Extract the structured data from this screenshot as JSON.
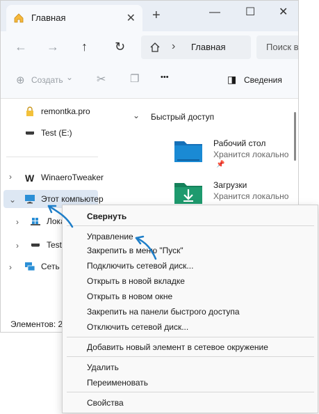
{
  "window": {
    "tab_title": "Главная",
    "new_tab": "+",
    "controls": {
      "minimize": "—",
      "maximize": "☐",
      "close": "✕"
    },
    "tab_close": "✕"
  },
  "nav": {
    "back": "←",
    "forward": "→",
    "up": "↑",
    "refresh": "↻",
    "address": "Главная",
    "address_chevron": "›",
    "search_placeholder": "Поиск в"
  },
  "toolbar": {
    "create_label": "Создать",
    "create_chevron": "⌄",
    "more": "•••",
    "details_label": "Сведения"
  },
  "sidebar": {
    "items": [
      {
        "label": "remontka.pro"
      },
      {
        "label": "Test (E:)"
      },
      {
        "label": "WinaeroTweaker"
      },
      {
        "label": "Этот компьютер"
      },
      {
        "label": "Лока"
      },
      {
        "label": "Test"
      },
      {
        "label": "Сеть"
      }
    ],
    "status": "Элементов: 2"
  },
  "main": {
    "section_title": "Быстрый доступ",
    "folders": [
      {
        "name": "Рабочий стол",
        "subtitle": "Хранится локально"
      },
      {
        "name": "Загрузки",
        "subtitle": "Хранится локально"
      }
    ]
  },
  "context_menu": {
    "items": [
      "Свернуть",
      "Управление",
      "Закрепить в меню \"Пуск\"",
      "Подключить сетевой диск...",
      "Открыть в новой вкладке",
      "Открыть в новом окне",
      "Закрепить на панели быстрого доступа",
      "Отключить сетевой диск...",
      "Добавить новый элемент в сетевое окружение",
      "Удалить",
      "Переименовать",
      "Свойства"
    ]
  },
  "colors": {
    "accent": "#1e7ec8",
    "selection": "#dde7f3",
    "folder_blue": "#1a8ad4",
    "folder_green": "#1e9a6e"
  }
}
